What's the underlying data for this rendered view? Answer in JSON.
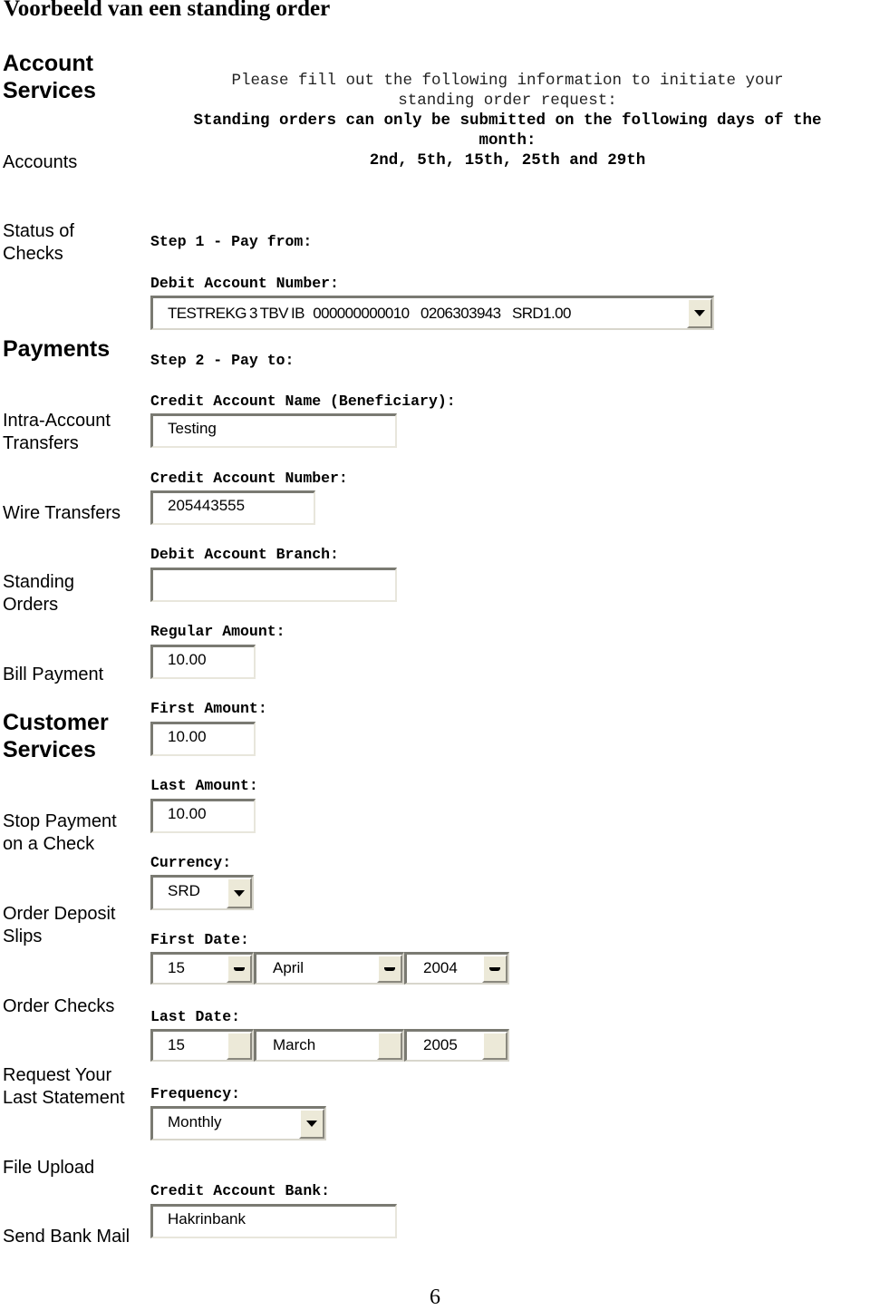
{
  "document": {
    "title": "Voorbeeld van een standing order",
    "page_number": "6"
  },
  "sidebar": {
    "sections": [
      {
        "heading": "Account Services",
        "items": [
          "Accounts",
          "Status of Checks"
        ]
      },
      {
        "heading": "Payments",
        "items": [
          "Intra-Account Transfers",
          "Wire Transfers",
          "Standing Orders",
          "Bill Payment"
        ]
      },
      {
        "heading": "Customer Services",
        "items": [
          "Stop Payment on a Check",
          "Order Deposit Slips",
          "Order Checks",
          "Request Your Last Statement",
          "File Upload",
          "Send Bank Mail"
        ]
      }
    ]
  },
  "intro": {
    "line1": "Please fill out the following information to initiate your",
    "line2": "standing order request:",
    "line3": "Standing orders can only be submitted on the following days of the",
    "line4": "month:",
    "line5": "2nd, 5th, 15th, 25th and 29th"
  },
  "form": {
    "step1": "Step 1 - Pay from:",
    "debit_account_number": {
      "label": "Debit Account Number:",
      "value": "TESTREKG 3 TBV IB   000000000010    0206303943    SRD1.00"
    },
    "step2": "Step 2 - Pay to:",
    "credit_account_name": {
      "label": "Credit Account Name (Beneficiary):",
      "value": "Testing"
    },
    "credit_account_number": {
      "label": "Credit Account Number:",
      "value": "205443555"
    },
    "debit_account_branch": {
      "label": "Debit Account Branch:",
      "value": ""
    },
    "regular_amount": {
      "label": "Regular Amount:",
      "value": "10.00"
    },
    "first_amount": {
      "label": "First Amount:",
      "value": "10.00"
    },
    "last_amount": {
      "label": "Last Amount:",
      "value": "10.00"
    },
    "currency": {
      "label": "Currency:",
      "value": "SRD"
    },
    "first_date": {
      "label": "First Date:",
      "day": "15",
      "month": "April",
      "year": "2004"
    },
    "last_date": {
      "label": "Last Date:",
      "day": "15",
      "month": "March",
      "year": "2005"
    },
    "frequency": {
      "label": "Frequency:",
      "value": "Monthly"
    },
    "credit_account_bank": {
      "label": "Credit Account Bank:",
      "value": "Hakrinbank"
    }
  }
}
